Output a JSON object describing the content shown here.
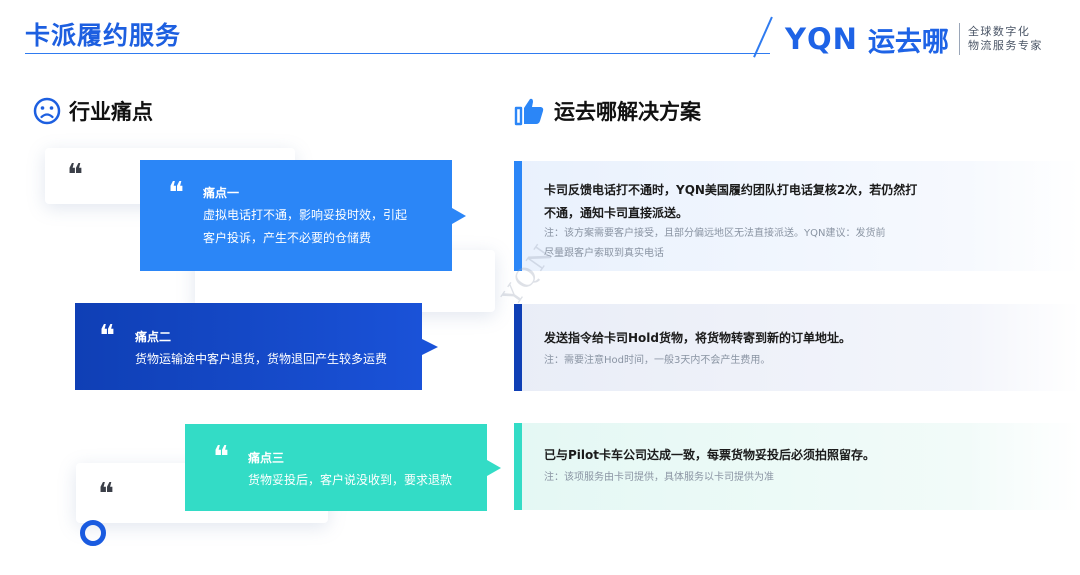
{
  "header": {
    "title": "卡派履约服务",
    "logo_en": "YQN",
    "logo_cn": "运去哪",
    "tagline_line1": "全球数字化",
    "tagline_line2": "物流服务专家"
  },
  "left_section": {
    "heading": "行业痛点",
    "icon": "sad-face-icon",
    "quote_mark": "❝",
    "pain_points": [
      {
        "title": "痛点一",
        "desc_line1": "虚拟电话打不通，影响妥投时效，引起",
        "desc_line2": "客户投诉，产生不必要的仓储费"
      },
      {
        "title": "痛点二",
        "desc_line1": "货物运输途中客户退货，货物退回产生较多运费"
      },
      {
        "title": "痛点三",
        "desc_line1": "货物妥投后，客户说没收到，要求退款"
      }
    ]
  },
  "right_section": {
    "heading": "运去哪解决方案",
    "icon": "thumbs-up-icon",
    "solutions": [
      {
        "main_line1": "卡司反馈电话打不通时，YQN美国履约团队打电话复核2次，若仍然打",
        "main_line2": "不通，通知卡司直接派送。",
        "note_line1": "注：该方案需要客户接受，且部分偏远地区无法直接派送。YQN建议：发货前",
        "note_line2": "尽量跟客户索取到真实电话"
      },
      {
        "main_line1": "发送指令给卡司Hold货物，将货物转寄到新的订单地址。",
        "note_line1": "注：需要注意Hod时间，一般3天内不会产生费用。"
      },
      {
        "main_line1": "已与Pilot卡车公司达成一致，每票货物妥投后必须拍照留存。",
        "note_line1": "注：该项服务由卡司提供，具体服务以卡司提供为准"
      }
    ]
  },
  "watermark": "YQN",
  "colors": {
    "primary_blue": "#2b86f7",
    "dark_blue": "#0f3fb5",
    "teal": "#33dcc6",
    "title_blue": "#1d5fe0"
  }
}
